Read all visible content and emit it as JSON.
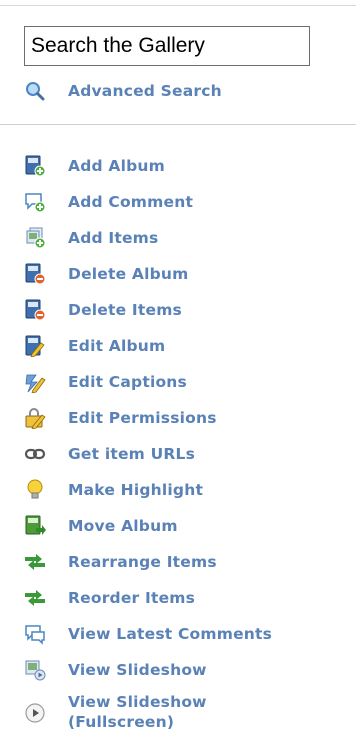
{
  "search": {
    "placeholder": "Search the Gallery"
  },
  "advanced": {
    "label": "Advanced Search",
    "icon": "magnifier-icon"
  },
  "colors": {
    "link": "#5a82b6"
  },
  "menu": [
    {
      "label": "Add Album",
      "icon": "album-add-icon"
    },
    {
      "label": "Add Comment",
      "icon": "comment-add-icon"
    },
    {
      "label": "Add Items",
      "icon": "items-add-icon"
    },
    {
      "label": "Delete Album",
      "icon": "album-delete-icon"
    },
    {
      "label": "Delete Items",
      "icon": "items-delete-icon"
    },
    {
      "label": "Edit Album",
      "icon": "album-edit-icon"
    },
    {
      "label": "Edit Captions",
      "icon": "captions-edit-icon"
    },
    {
      "label": "Edit Permissions",
      "icon": "permissions-edit-icon"
    },
    {
      "label": "Get item URLs",
      "icon": "link-icon"
    },
    {
      "label": "Make Highlight",
      "icon": "lightbulb-icon"
    },
    {
      "label": "Move Album",
      "icon": "album-move-icon"
    },
    {
      "label": "Rearrange Items",
      "icon": "rearrange-icon"
    },
    {
      "label": "Reorder Items",
      "icon": "reorder-icon"
    },
    {
      "label": "View Latest Comments",
      "icon": "comments-view-icon"
    },
    {
      "label": "View Slideshow",
      "icon": "slideshow-icon"
    },
    {
      "label": "View Slideshow (Fullscreen)",
      "icon": "play-circle-icon"
    }
  ]
}
